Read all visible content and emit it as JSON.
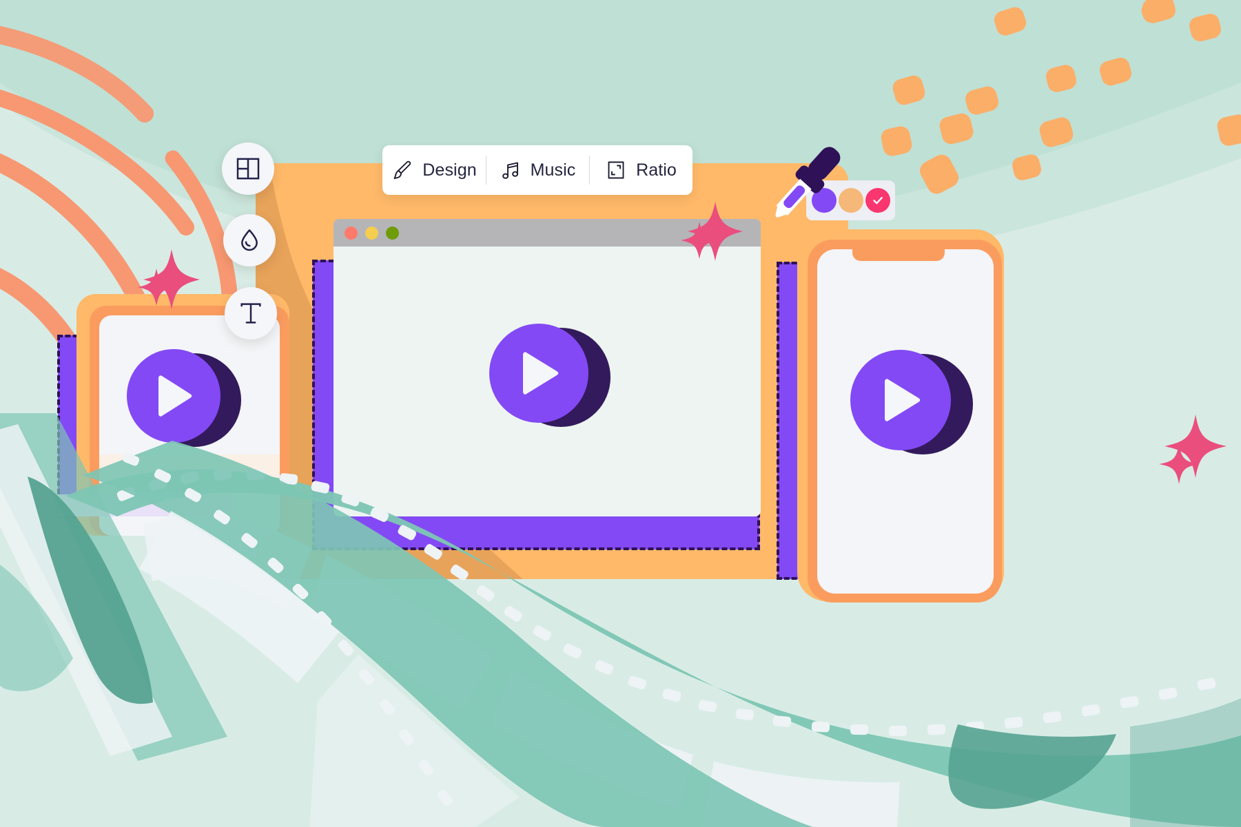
{
  "scene": {
    "title": "Video editor hero illustration",
    "background_color": "#d8ece5",
    "background_wave_color": "#c8e4da",
    "accent_orange": "#f79f6b",
    "accent_purple": "#8349f5",
    "accent_pink": "#ea4e7d",
    "accent_teal": "#74c3b0"
  },
  "toolbar": {
    "items": [
      {
        "id": "design",
        "label": "Design",
        "icon": "paintbrush-icon"
      },
      {
        "id": "music",
        "label": "Music",
        "icon": "music-note-icon"
      },
      {
        "id": "ratio",
        "label": "Ratio",
        "icon": "aspect-ratio-icon"
      }
    ]
  },
  "tool_buttons": [
    {
      "id": "layout",
      "icon": "layout-grid-icon",
      "label": "Layout"
    },
    {
      "id": "color",
      "icon": "water-drop-icon",
      "label": "Color"
    },
    {
      "id": "text",
      "icon": "text-tool-icon",
      "label": "Text"
    }
  ],
  "window": {
    "traffic_lights": [
      {
        "name": "close-dot",
        "color": "#ff7a6b"
      },
      {
        "name": "minimize-dot",
        "color": "#f5cd4f"
      },
      {
        "name": "maximize-dot",
        "color": "#6f9c08"
      }
    ],
    "title_bar_color": "#b5b5b8",
    "canvas_color": "#edf4f1",
    "selection_color": "#8349f5",
    "selection_dash_color": "#2e1157"
  },
  "previews": [
    {
      "id": "tablet-preview",
      "device": "tablet",
      "play_label": "Play"
    },
    {
      "id": "desktop-preview",
      "device": "desktop",
      "play_label": "Play"
    },
    {
      "id": "phone-preview",
      "device": "phone",
      "play_label": "Play"
    }
  ],
  "color_picker": {
    "tool": "eyedropper-icon",
    "swatches": [
      {
        "name": "swatch-purple",
        "color": "#8349f5",
        "selected": false
      },
      {
        "name": "swatch-orange",
        "color": "#f5b878",
        "selected": false
      },
      {
        "name": "swatch-pink",
        "color": "#f9366f",
        "selected": true
      }
    ],
    "selected_indicator": "check-icon"
  },
  "decorations": {
    "sparkle_count": 6,
    "sparkle_color": "#ea4e7d",
    "swirl_color": "#f79872",
    "dash_color": "#fbae68",
    "film_strip_color": "#74c3b0",
    "film_strip_shadow": "#5aa48f"
  }
}
